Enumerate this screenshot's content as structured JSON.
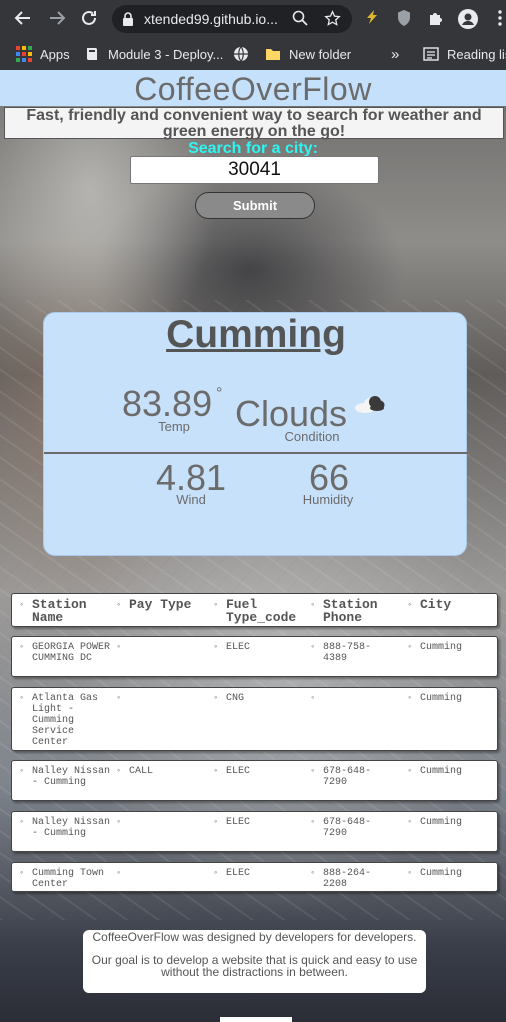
{
  "browser": {
    "url": "xtended99.github.io...",
    "bookmarks": [
      "Apps",
      "Module 3 - Deploy...",
      "New folder",
      "Reading list"
    ],
    "more_bookmarks": "»"
  },
  "site": {
    "title": "CoffeeOverFlow",
    "tagline": "Fast, friendly and convenient way to search for weather and green energy on the go!",
    "search_label": "Search for a city:",
    "search_value": "30041",
    "submit_label": "Submit"
  },
  "weather": {
    "city": "Cumming",
    "temp": "83.89",
    "temp_unit": "°",
    "temp_label": "Temp",
    "condition": "Clouds",
    "condition_label": "Condition",
    "wind": "4.81",
    "wind_label": "Wind",
    "humidity": "66",
    "humidity_label": "Humidity",
    "condition_icon": "cloud-sun-icon"
  },
  "stations": {
    "headers": [
      "Station Name",
      "Pay Type",
      "Fuel Type_code",
      "Station Phone",
      "City"
    ],
    "rows": [
      [
        "GEORGIA POWER CUMMING DC",
        "",
        "ELEC",
        "888-758-4389",
        "Cumming"
      ],
      [
        "Atlanta Gas Light - Cumming Service Center",
        "",
        "CNG",
        "",
        "Cumming"
      ],
      [
        "Nalley Nissan - Cumming",
        "CALL",
        "ELEC",
        "678-648-7290",
        "Cumming"
      ],
      [
        "Nalley Nissan - Cumming",
        "",
        "ELEC",
        "678-648-7290",
        "Cumming"
      ],
      [
        "Cumming Town Center",
        "",
        "ELEC",
        "888-264-2208",
        "Cumming"
      ]
    ]
  },
  "footer": {
    "line1": "CoffeeOverFlow was designed by developers for developers.",
    "line2": "Our goal is to develop a website that is quick and easy to use without the distractions in between."
  }
}
